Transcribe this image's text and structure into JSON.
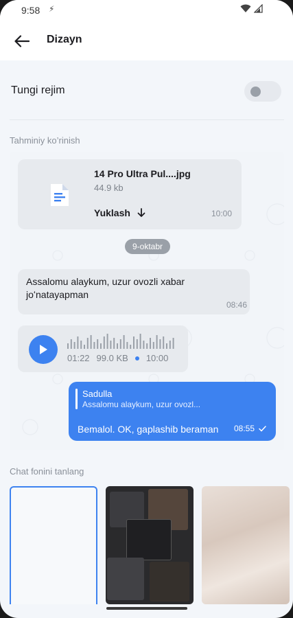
{
  "status": {
    "time": "9:58"
  },
  "appbar": {
    "title": "Dizayn"
  },
  "night_mode": {
    "label": "Tungi rejim",
    "enabled": false
  },
  "preview": {
    "section_label": "Tahminiy ko’rinish",
    "file_message": {
      "name": "14 Pro Ultra Pul....jpg",
      "size": "44.9 kb",
      "download_label": "Yuklash",
      "time": "10:00"
    },
    "date_chip": "9-oktabr",
    "text_message": {
      "text": "Assalomu alaykum, uzur ovozli xabar joʻnatayapman",
      "time": "08:46"
    },
    "voice_message": {
      "duration": "01:22",
      "size": "99.0 KB",
      "time": "10:00"
    },
    "outgoing_message": {
      "reply_name": "Sadulla",
      "reply_text": "Assalomu alaykum, uzur ovozl...",
      "text": "Bemalol. OK, gaplashib beraman",
      "time": "08:55"
    }
  },
  "backgrounds": {
    "section_label": "Chat fonini tanlang"
  },
  "colors": {
    "accent": "#3d82f0",
    "bubble": "#e7eaee"
  }
}
